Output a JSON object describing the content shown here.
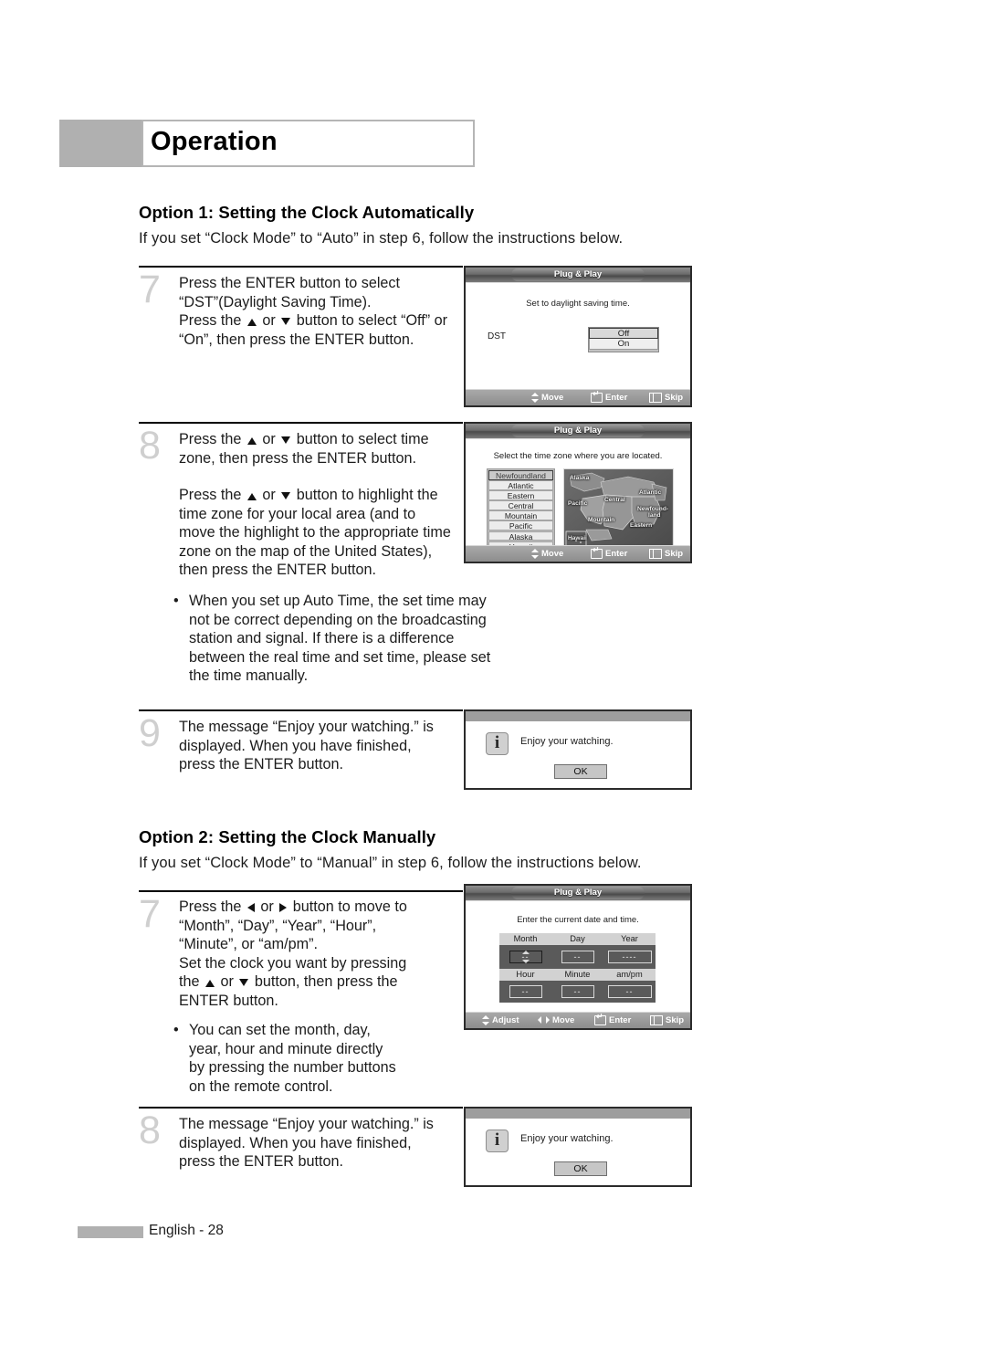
{
  "header": {
    "title": "Operation"
  },
  "option1": {
    "title": "Option 1: Setting the Clock Automatically",
    "subtitle": "If you set “Clock Mode” to “Auto” in step 6, follow the instructions below."
  },
  "option2": {
    "title": "Option 2: Setting the Clock Manually",
    "subtitle": "If you set “Clock Mode” to “Manual” in step 6, follow the instructions below."
  },
  "steps": {
    "s7": {
      "number": "7",
      "line1": "Press the ENTER button to select",
      "line2": "“DST”(Daylight Saving Time).",
      "line3a": "Press the ",
      "line3b": " or ",
      "line3c": " button to select “Off” or",
      "line4": "“On”, then press the ENTER button."
    },
    "s8": {
      "number": "8",
      "p1a": "Press the ",
      "p1b": " or ",
      "p1c": " button to select time",
      "p2": "zone, then press the ENTER button.",
      "p3a": "Press the ",
      "p3b": " or ",
      "p3c": " button to highlight the",
      "p4": "time zone for your local area (and to",
      "p5": "move the highlight to the appropriate time",
      "p6": "zone on the map of the United States),",
      "p7": "then press the ENTER button.",
      "note_l1": "When you set up Auto Time, the set time may",
      "note_l2": "not be correct depending on the broadcasting",
      "note_l3": "station and signal. If there is a difference",
      "note_l4": "between the real time and set time, please set",
      "note_l5": "the time manually."
    },
    "s9": {
      "number": "9",
      "line1": "The message “Enjoy your watching.” is",
      "line2": "displayed. When you have finished,",
      "line3": "press the ENTER button."
    },
    "m7": {
      "number": "7",
      "l1a": "Press the ",
      "l1b": " or ",
      "l1c": " button to move to",
      "l2": "“Month”, “Day”, “Year”, “Hour”,",
      "l3": "“Minute”, or “am/pm”.",
      "l4": "Set the clock you want by pressing",
      "l5a": "the ",
      "l5b": " or ",
      "l5c": " button, then press the",
      "l6": "ENTER button.",
      "note_l1": "You can set the month, day,",
      "note_l2": "year, hour and minute directly",
      "note_l3": "by pressing the number buttons",
      "note_l4": "on the remote control."
    },
    "m8": {
      "number": "8",
      "line1": "The message “Enjoy your watching.” is",
      "line2": "displayed. When you have finished,",
      "line3": "press the ENTER button."
    }
  },
  "osd": {
    "title": "Plug & Play",
    "dst": {
      "prompt": "Set to daylight saving time.",
      "label": "DST",
      "options": [
        "Off",
        "On"
      ],
      "selected": "Off"
    },
    "timezone": {
      "prompt": "Select the time zone where you are located.",
      "items": [
        "Newfoundland",
        "Atlantic",
        "Eastern",
        "Central",
        "Mountain",
        "Pacific",
        "Alaska",
        "Hawaii"
      ],
      "selected": "Newfoundland",
      "map_labels": [
        "Alaska",
        "Pacific",
        "Central",
        "Atlantic",
        "Newfound-",
        "land",
        "Mountain",
        "Eastern",
        "Hawaii"
      ]
    },
    "clock": {
      "prompt": "Enter the current date and time.",
      "headers_row1": [
        "Month",
        "Day",
        "Year"
      ],
      "values_row1": [
        "--",
        "--",
        "----"
      ],
      "headers_row2": [
        "Hour",
        "Minute",
        "am/pm"
      ],
      "values_row2": [
        "--",
        "--",
        "--"
      ],
      "active_field": "Month"
    },
    "footer_move": [
      "Move",
      "Enter",
      "Skip"
    ],
    "footer_adjust": [
      "Adjust",
      "Move",
      "Enter",
      "Skip"
    ]
  },
  "dialog": {
    "message": "Enjoy your watching.",
    "ok_label": "OK",
    "icon": "info-icon"
  },
  "footer": {
    "page": "English - 28"
  }
}
